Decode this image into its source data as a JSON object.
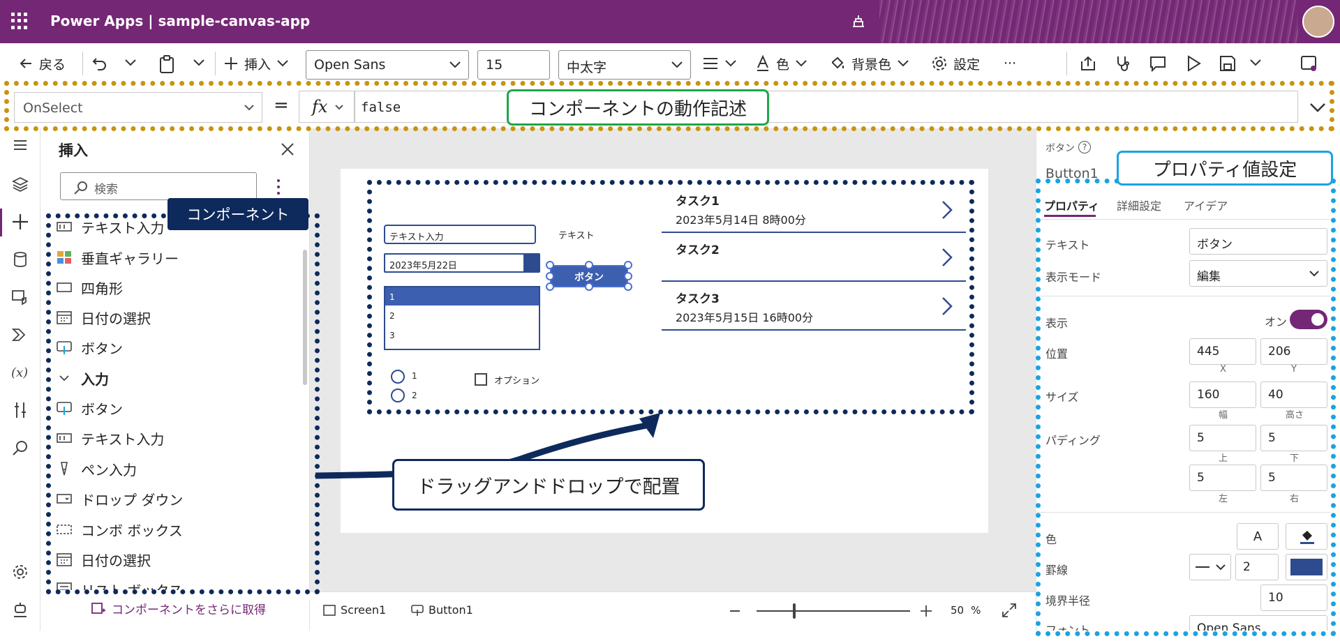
{
  "app": {
    "title": "Power Apps  |  sample-canvas-app"
  },
  "toolbar": {
    "back": "戻る",
    "insert": "挿入",
    "font": "Open Sans",
    "font_size": "15",
    "font_weight": "中太字",
    "color": "色",
    "fill": "背景色",
    "settings": "設定",
    "more": "···"
  },
  "formula": {
    "property": "OnSelect",
    "equals": "=",
    "fx": "fx",
    "value": "false"
  },
  "insert_pane": {
    "title": "挿入",
    "search_placeholder": "検索",
    "items": [
      {
        "label": "テキスト入力",
        "icon": "text-input-icon"
      },
      {
        "label": "垂直ギャラリー",
        "icon": "gallery-icon"
      },
      {
        "label": "四角形",
        "icon": "rectangle-icon"
      },
      {
        "label": "日付の選択",
        "icon": "calendar-icon"
      },
      {
        "label": "ボタン",
        "icon": "button-icon"
      }
    ],
    "section": "入力",
    "input_items": [
      {
        "label": "ボタン",
        "icon": "button-icon"
      },
      {
        "label": "テキスト入力",
        "icon": "text-input-icon"
      },
      {
        "label": "ペン入力",
        "icon": "pen-icon"
      },
      {
        "label": "ドロップ ダウン",
        "icon": "dropdown-icon"
      },
      {
        "label": "コンボ ボックス",
        "icon": "combobox-icon"
      },
      {
        "label": "日付の選択",
        "icon": "calendar-icon"
      },
      {
        "label": "リスト ボックス",
        "icon": "listbox-icon"
      }
    ],
    "more_components": "コンポーネントをさらに取得"
  },
  "canvas": {
    "text_input": "テキスト入力",
    "label": "テキスト",
    "date": "2023年5月22日",
    "button": "ボタン",
    "list": [
      "1",
      "2",
      "3"
    ],
    "radios": [
      "1",
      "2"
    ],
    "checkbox": "オプション",
    "tasks": [
      {
        "title": "タスク1",
        "date": "2023年5月14日 8時00分"
      },
      {
        "title": "タスク2",
        "date": ""
      },
      {
        "title": "タスク3",
        "date": "2023年5月15日 16時00分"
      }
    ]
  },
  "status": {
    "screen": "Screen1",
    "control": "Button1",
    "zoom": "50",
    "zoom_unit": "%"
  },
  "props": {
    "control_type": "ボタン",
    "control_name": "Button1",
    "tabs": [
      "プロパティ",
      "詳細設定",
      "アイデア"
    ],
    "text_label": "テキスト",
    "text_value": "ボタン",
    "mode_label": "表示モード",
    "mode_value": "編集",
    "visible_label": "表示",
    "visible_value": "オン",
    "visible_on": true,
    "position_label": "位置",
    "x": "445",
    "y": "206",
    "x_label": "X",
    "y_label": "Y",
    "size_label": "サイズ",
    "width": "160",
    "height": "40",
    "width_label": "幅",
    "height_label": "高さ",
    "padding_label": "パディング",
    "pad_top": "5",
    "pad_bottom": "5",
    "pad_left": "5",
    "pad_right": "5",
    "pad_top_label": "上",
    "pad_bottom_label": "下",
    "pad_left_label": "左",
    "pad_right_label": "右",
    "color_label": "色",
    "color_text_icon": "A",
    "border_label": "罫線",
    "border_width": "2",
    "border_color": "#2f4b8f",
    "radius_label": "境界半径",
    "radius_value": "10",
    "font_label": "フォント",
    "font_value": "Open Sans"
  },
  "annotations": {
    "formula": "コンポーネントの動作記述",
    "properties": "プロパティ値設定",
    "components": "コンポーネント",
    "drag": "ドラッグアンドドロップで配置"
  },
  "colors": {
    "brand": "#742774",
    "accent_blue": "#2f4b8f",
    "annotation_gold": "#c8940f",
    "annotation_navy": "#0e2a5c",
    "annotation_cyan": "#1aa3e0",
    "annotation_green": "#1fa64a"
  }
}
